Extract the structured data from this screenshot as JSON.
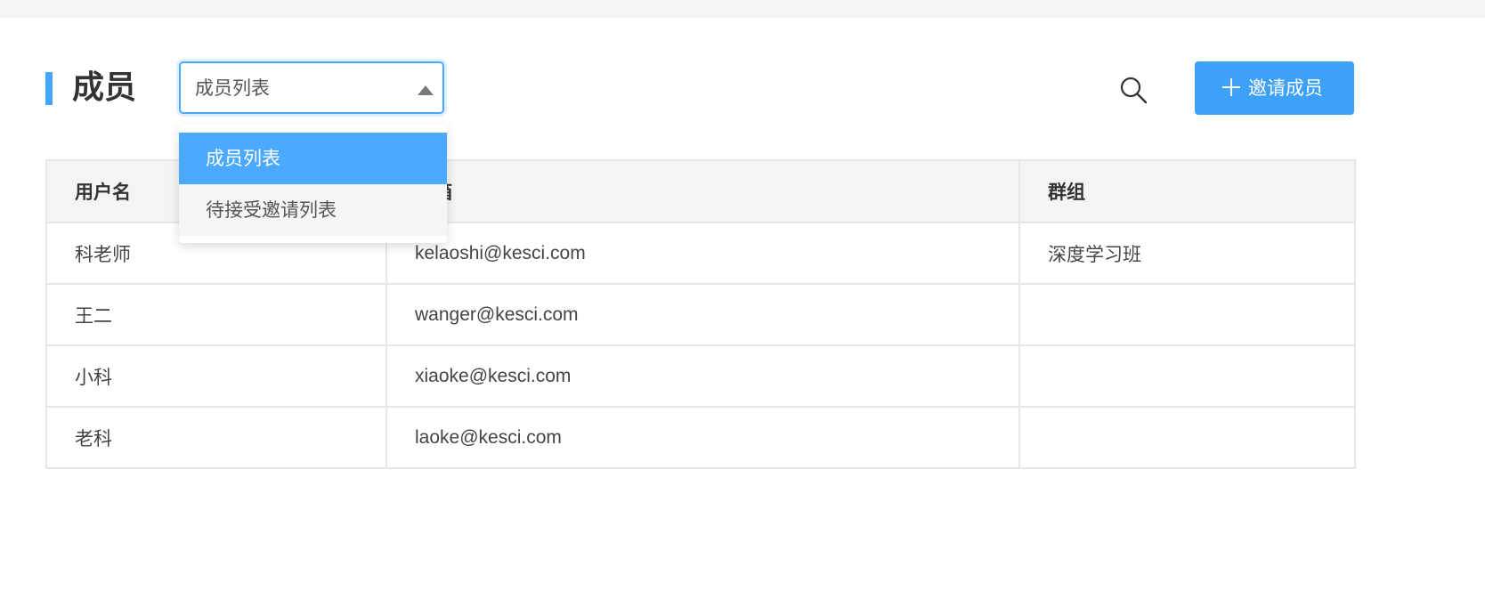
{
  "page": {
    "title": "成员"
  },
  "filter": {
    "selected": "成员列表",
    "options": [
      "成员列表",
      "待接受邀请列表"
    ]
  },
  "actions": {
    "invite_label": "邀请成员",
    "search_icon": "search-icon",
    "plus_icon": "plus-icon"
  },
  "colors": {
    "accent": "#44a6ff",
    "button": "#3ea1f8",
    "header_bg": "#f4f4f5",
    "border": "#e7e7e9"
  },
  "table": {
    "columns": [
      "用户名",
      "邮箱",
      "群组"
    ],
    "rows": [
      {
        "username": "科老师",
        "email": "kelaoshi@kesci.com",
        "group": "深度学习班"
      },
      {
        "username": "王二",
        "email": "wanger@kesci.com",
        "group": ""
      },
      {
        "username": "小科",
        "email": "xiaoke@kesci.com",
        "group": ""
      },
      {
        "username": "老科",
        "email": "laoke@kesci.com",
        "group": ""
      }
    ]
  }
}
